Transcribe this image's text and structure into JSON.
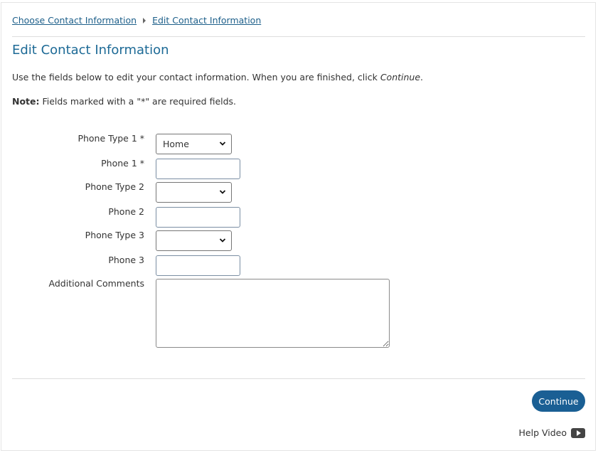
{
  "breadcrumb": {
    "items": [
      {
        "label": "Choose Contact Information"
      },
      {
        "label": "Edit Contact Information"
      }
    ]
  },
  "page": {
    "title": "Edit Contact Information",
    "intro_text": "Use the fields below to edit your contact information. When you are finished, click ",
    "intro_emphasis": "Continue",
    "intro_end": ".",
    "note_label": "Note:",
    "note_text": " Fields marked with a \"*\" are required fields."
  },
  "form": {
    "phone_type_1": {
      "label": "Phone Type 1 *",
      "value": "Home"
    },
    "phone_1": {
      "label": "Phone 1 *",
      "value": ""
    },
    "phone_type_2": {
      "label": "Phone Type 2",
      "value": ""
    },
    "phone_2": {
      "label": "Phone 2",
      "value": ""
    },
    "phone_type_3": {
      "label": "Phone Type 3",
      "value": ""
    },
    "phone_3": {
      "label": "Phone 3",
      "value": ""
    },
    "comments": {
      "label": "Additional Comments",
      "value": ""
    }
  },
  "actions": {
    "continue_label": "Continue",
    "help_label": "Help Video"
  },
  "colors": {
    "link": "#1d5f8a",
    "title": "#1d6a96",
    "button": "#1a5f94"
  },
  "icons": {
    "breadcrumb_separator": "caret-right-icon",
    "select_chevron": "chevron-down-icon",
    "help": "video-play-icon"
  }
}
